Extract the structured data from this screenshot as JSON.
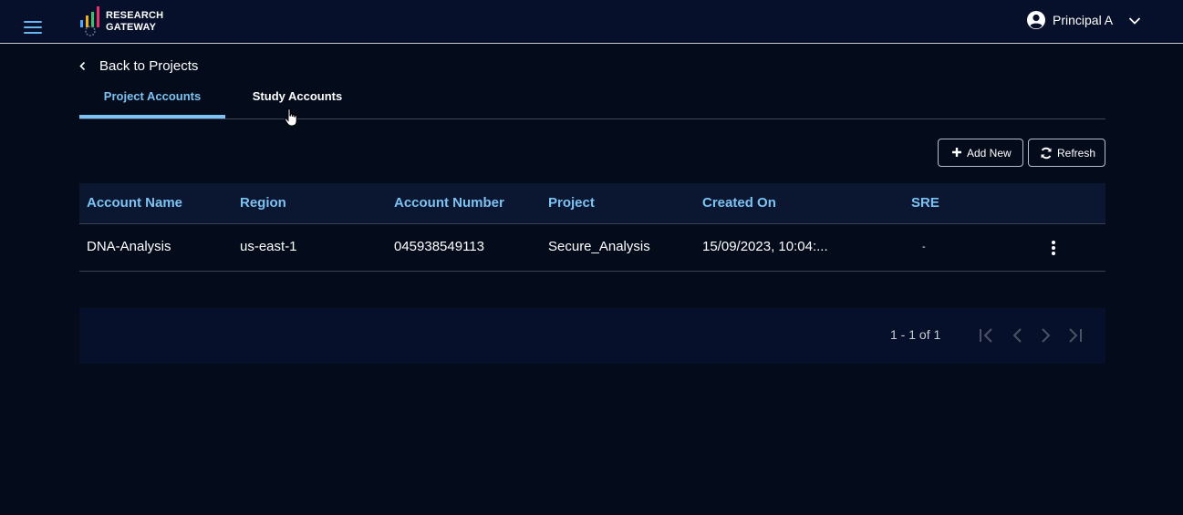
{
  "app": {
    "logo_line1": "RESEARCH",
    "logo_line2": "GATEWAY"
  },
  "header": {
    "user_name": "Principal A"
  },
  "nav": {
    "back_label": "Back to Projects"
  },
  "tabs": [
    {
      "label": "Project Accounts",
      "active": true
    },
    {
      "label": "Study Accounts",
      "active": false
    }
  ],
  "toolbar": {
    "add_label": "Add New",
    "refresh_label": "Refresh"
  },
  "table": {
    "columns": [
      "Account Name",
      "Region",
      "Account Number",
      "Project",
      "Created On",
      "SRE"
    ],
    "rows": [
      {
        "account_name": "DNA-Analysis",
        "region": "us-east-1",
        "account_number": "045938549113",
        "project": "Secure_Analysis",
        "created_on": "15/09/2023, 10:04:...",
        "sre": "-"
      }
    ]
  },
  "pagination": {
    "range_label": "1 - 1 of 1"
  },
  "colors": {
    "accent": "#7cc2f2",
    "background": "#040b1a",
    "header_bg": "#07102a"
  },
  "icons": [
    "menu-icon",
    "user-circle-icon",
    "chevron-down-icon",
    "chevron-left-icon",
    "plus-icon",
    "refresh-icon",
    "more-vertical-icon",
    "first-page-icon",
    "prev-page-icon",
    "next-page-icon",
    "last-page-icon"
  ]
}
